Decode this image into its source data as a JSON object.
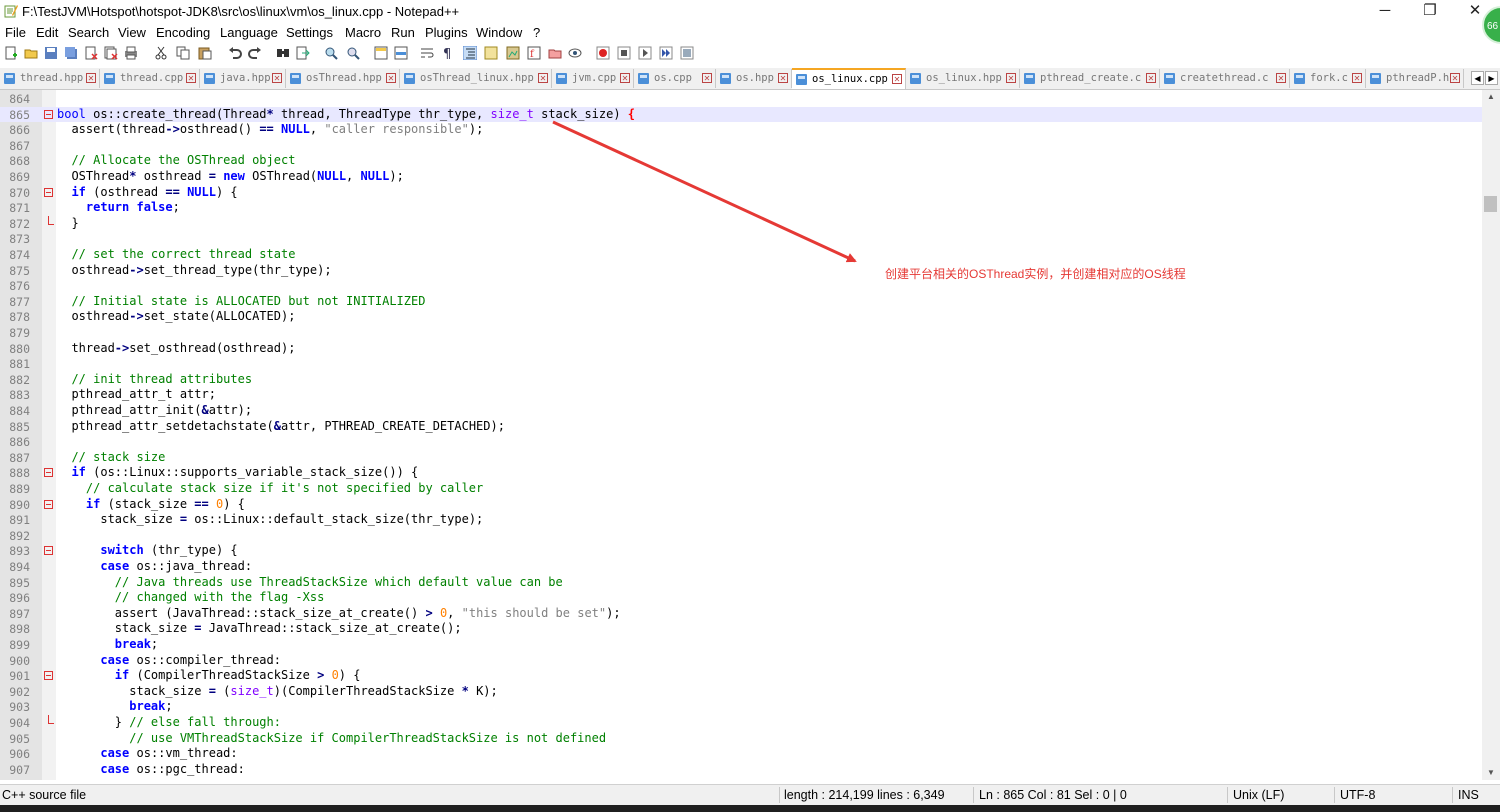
{
  "window": {
    "title": "F:\\TestJVM\\Hotspot\\hotspot-JDK8\\src\\os\\linux\\vm\\os_linux.cpp - Notepad++",
    "badge": "66",
    "minimize": "─",
    "maximize": "❐",
    "close": "✕"
  },
  "menu": [
    "File",
    "Edit",
    "Search",
    "View",
    "Encoding",
    "Language",
    "Settings",
    "Macro",
    "Run",
    "Plugins",
    "Window",
    "?"
  ],
  "tabs": [
    {
      "label": "thread.hpp",
      "active": false
    },
    {
      "label": "thread.cpp",
      "active": false
    },
    {
      "label": "java.hpp",
      "active": false
    },
    {
      "label": "osThread.hpp",
      "active": false
    },
    {
      "label": "osThread_linux.hpp",
      "active": false
    },
    {
      "label": "jvm.cpp",
      "active": false
    },
    {
      "label": "os.cpp",
      "active": false
    },
    {
      "label": "os.hpp",
      "active": false
    },
    {
      "label": "os_linux.cpp",
      "active": true
    },
    {
      "label": "os_linux.hpp",
      "active": false
    },
    {
      "label": "pthread_create.c",
      "active": false
    },
    {
      "label": "createthread.c",
      "active": false
    },
    {
      "label": "fork.c",
      "active": false
    },
    {
      "label": "pthreadP.h",
      "active": false
    }
  ],
  "code_lines": [
    {
      "num": "864",
      "html": ""
    },
    {
      "num": "865",
      "html": "<span class=\"k\" style=\"font-weight:normal\">bool</span> os::create_thread(Thread<span class=\"o\">*</span> thread, ThreadType thr_type, <span class=\"t\">size_t</span> stack_size) <span class=\"o\" style=\"color:#ff0000\">{</span>"
    },
    {
      "num": "866",
      "html": "  assert(thread<span class=\"o\">-&gt;</span>osthread() <span class=\"o\">==</span> <span class=\"k\">NULL</span>, <span class=\"s\">\"caller responsible\"</span>);"
    },
    {
      "num": "867",
      "html": ""
    },
    {
      "num": "868",
      "html": "  <span class=\"c\">// Allocate the OSThread object</span>"
    },
    {
      "num": "869",
      "html": "  OSThread<span class=\"o\">*</span> osthread <span class=\"o\">=</span> <span class=\"k\">new</span> OSThread(<span class=\"k\">NULL</span>, <span class=\"k\">NULL</span>);"
    },
    {
      "num": "870",
      "html": "  <span class=\"k\">if</span> (osthread <span class=\"o\">==</span> <span class=\"k\">NULL</span>) {"
    },
    {
      "num": "871",
      "html": "    <span class=\"k\">return</span> <span class=\"k\">false</span>;"
    },
    {
      "num": "872",
      "html": "  }"
    },
    {
      "num": "873",
      "html": ""
    },
    {
      "num": "874",
      "html": "  <span class=\"c\">// set the correct thread state</span>"
    },
    {
      "num": "875",
      "html": "  osthread<span class=\"o\">-&gt;</span>set_thread_type(thr_type);"
    },
    {
      "num": "876",
      "html": ""
    },
    {
      "num": "877",
      "html": "  <span class=\"c\">// Initial state is ALLOCATED but not INITIALIZED</span>"
    },
    {
      "num": "878",
      "html": "  osthread<span class=\"o\">-&gt;</span>set_state(ALLOCATED);"
    },
    {
      "num": "879",
      "html": ""
    },
    {
      "num": "880",
      "html": "  thread<span class=\"o\">-&gt;</span>set_osthread(osthread);"
    },
    {
      "num": "881",
      "html": ""
    },
    {
      "num": "882",
      "html": "  <span class=\"c\">// init thread attributes</span>"
    },
    {
      "num": "883",
      "html": "  pthread_attr_t attr;"
    },
    {
      "num": "884",
      "html": "  pthread_attr_init(<span class=\"o\">&amp;</span>attr);"
    },
    {
      "num": "885",
      "html": "  pthread_attr_setdetachstate(<span class=\"o\">&amp;</span>attr, PTHREAD_CREATE_DETACHED);"
    },
    {
      "num": "886",
      "html": ""
    },
    {
      "num": "887",
      "html": "  <span class=\"c\">// stack size</span>"
    },
    {
      "num": "888",
      "html": "  <span class=\"k\">if</span> (os::Linux::supports_variable_stack_size()) {"
    },
    {
      "num": "889",
      "html": "    <span class=\"c\">// calculate stack size if it's not specified by caller</span>"
    },
    {
      "num": "890",
      "html": "    <span class=\"k\">if</span> (stack_size <span class=\"o\">==</span> <span class=\"n\">0</span>) {"
    },
    {
      "num": "891",
      "html": "      stack_size <span class=\"o\">=</span> os::Linux::default_stack_size(thr_type);"
    },
    {
      "num": "892",
      "html": ""
    },
    {
      "num": "893",
      "html": "      <span class=\"k\">switch</span> (thr_type) {"
    },
    {
      "num": "894",
      "html": "      <span class=\"k\">case</span> os::java_thread:"
    },
    {
      "num": "895",
      "html": "        <span class=\"c\">// Java threads use ThreadStackSize which default value can be</span>"
    },
    {
      "num": "896",
      "html": "        <span class=\"c\">// changed with the flag -Xss</span>"
    },
    {
      "num": "897",
      "html": "        assert (JavaThread::stack_size_at_create() <span class=\"o\">&gt;</span> <span class=\"n\">0</span>, <span class=\"s\">\"this should be set\"</span>);"
    },
    {
      "num": "898",
      "html": "        stack_size <span class=\"o\">=</span> JavaThread::stack_size_at_create();"
    },
    {
      "num": "899",
      "html": "        <span class=\"k\">break</span>;"
    },
    {
      "num": "900",
      "html": "      <span class=\"k\">case</span> os::compiler_thread:"
    },
    {
      "num": "901",
      "html": "        <span class=\"k\">if</span> (CompilerThreadStackSize <span class=\"o\">&gt;</span> <span class=\"n\">0</span>) {"
    },
    {
      "num": "902",
      "html": "          stack_size <span class=\"o\">=</span> (<span class=\"t\">size_t</span>)(CompilerThreadStackSize <span class=\"o\">*</span> K);"
    },
    {
      "num": "903",
      "html": "          <span class=\"k\">break</span>;"
    },
    {
      "num": "904",
      "html": "        } <span class=\"c\">// else fall through:</span>"
    },
    {
      "num": "905",
      "html": "          <span class=\"c\">// use VMThreadStackSize if CompilerThreadStackSize is not defined</span>"
    },
    {
      "num": "906",
      "html": "      <span class=\"k\">case</span> os::vm_thread:"
    },
    {
      "num": "907",
      "html": "      <span class=\"k\">case</span> os::pgc_thread:"
    }
  ],
  "annotation": "创建平台相关的OSThread实例，并创建相对应的OS线程",
  "annotation_color": "#e53935",
  "status": {
    "filetype": "C++ source file",
    "length": "length : 214,199    lines : 6,349",
    "position": "Ln : 865    Col : 81    Sel : 0 | 0",
    "eol": "Unix (LF)",
    "encoding": "UTF-8",
    "mode": "INS"
  }
}
